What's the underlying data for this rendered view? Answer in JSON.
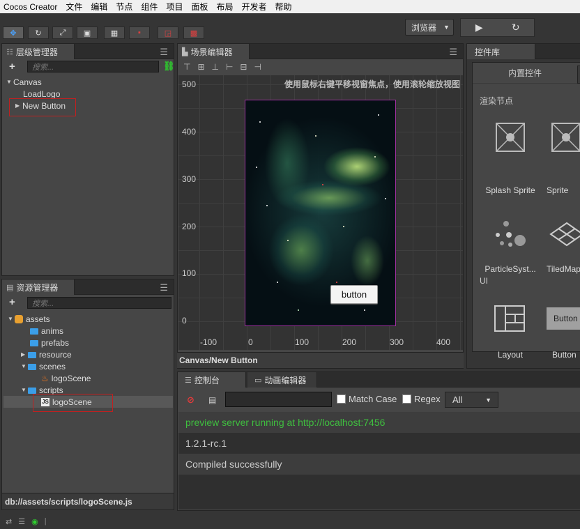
{
  "menu": {
    "app": "Cocos Creator",
    "items": [
      "文件",
      "编辑",
      "节点",
      "组件",
      "项目",
      "面板",
      "布局",
      "开发者",
      "帮助"
    ]
  },
  "toolbar": {
    "browser_select": "浏览器",
    "play_icon": "play-icon",
    "refresh_icon": "refresh-icon"
  },
  "hierarchy": {
    "title": "层级管理器",
    "search_placeholder": "搜索...",
    "nodes": [
      "Canvas",
      "LoadLogo",
      "New Button"
    ]
  },
  "assets": {
    "title": "资源管理器",
    "search_placeholder": "搜索...",
    "tree": [
      "assets",
      "anims",
      "prefabs",
      "resource",
      "scenes",
      "logoScene",
      "scripts",
      "logoScene"
    ],
    "footer": "db://assets/scripts/logoScene.js"
  },
  "scene": {
    "title": "场景编辑器",
    "hint": "使用鼠标右键平移视窗焦点，使用滚轮缩放视图",
    "y_ticks": [
      "500",
      "400",
      "300",
      "200",
      "100",
      "0"
    ],
    "x_ticks": [
      "-100",
      "0",
      "100",
      "200",
      "300",
      "400"
    ],
    "button_label": "button",
    "status": "Canvas/New Button"
  },
  "widgets": {
    "title": "控件库",
    "tab": "内置控件",
    "section_render": "渲染节点",
    "section_ui": "UI",
    "items": [
      "Splash Sprite",
      "Sprite",
      "ParticleSyst...",
      "TiledMap",
      "Layout",
      "Button"
    ],
    "button_preview": "Button"
  },
  "console": {
    "tab_console": "控制台",
    "tab_anim": "动画编辑器",
    "match_case": "Match Case",
    "regex": "Regex",
    "filter": "All",
    "lines": [
      {
        "text": "preview server running at http://localhost:7456",
        "color": "#3fbf3f"
      },
      {
        "text": "1.2.1-rc.1",
        "color": "#cccccc"
      },
      {
        "text": "Compiled successfully",
        "color": "#cccccc"
      }
    ]
  }
}
